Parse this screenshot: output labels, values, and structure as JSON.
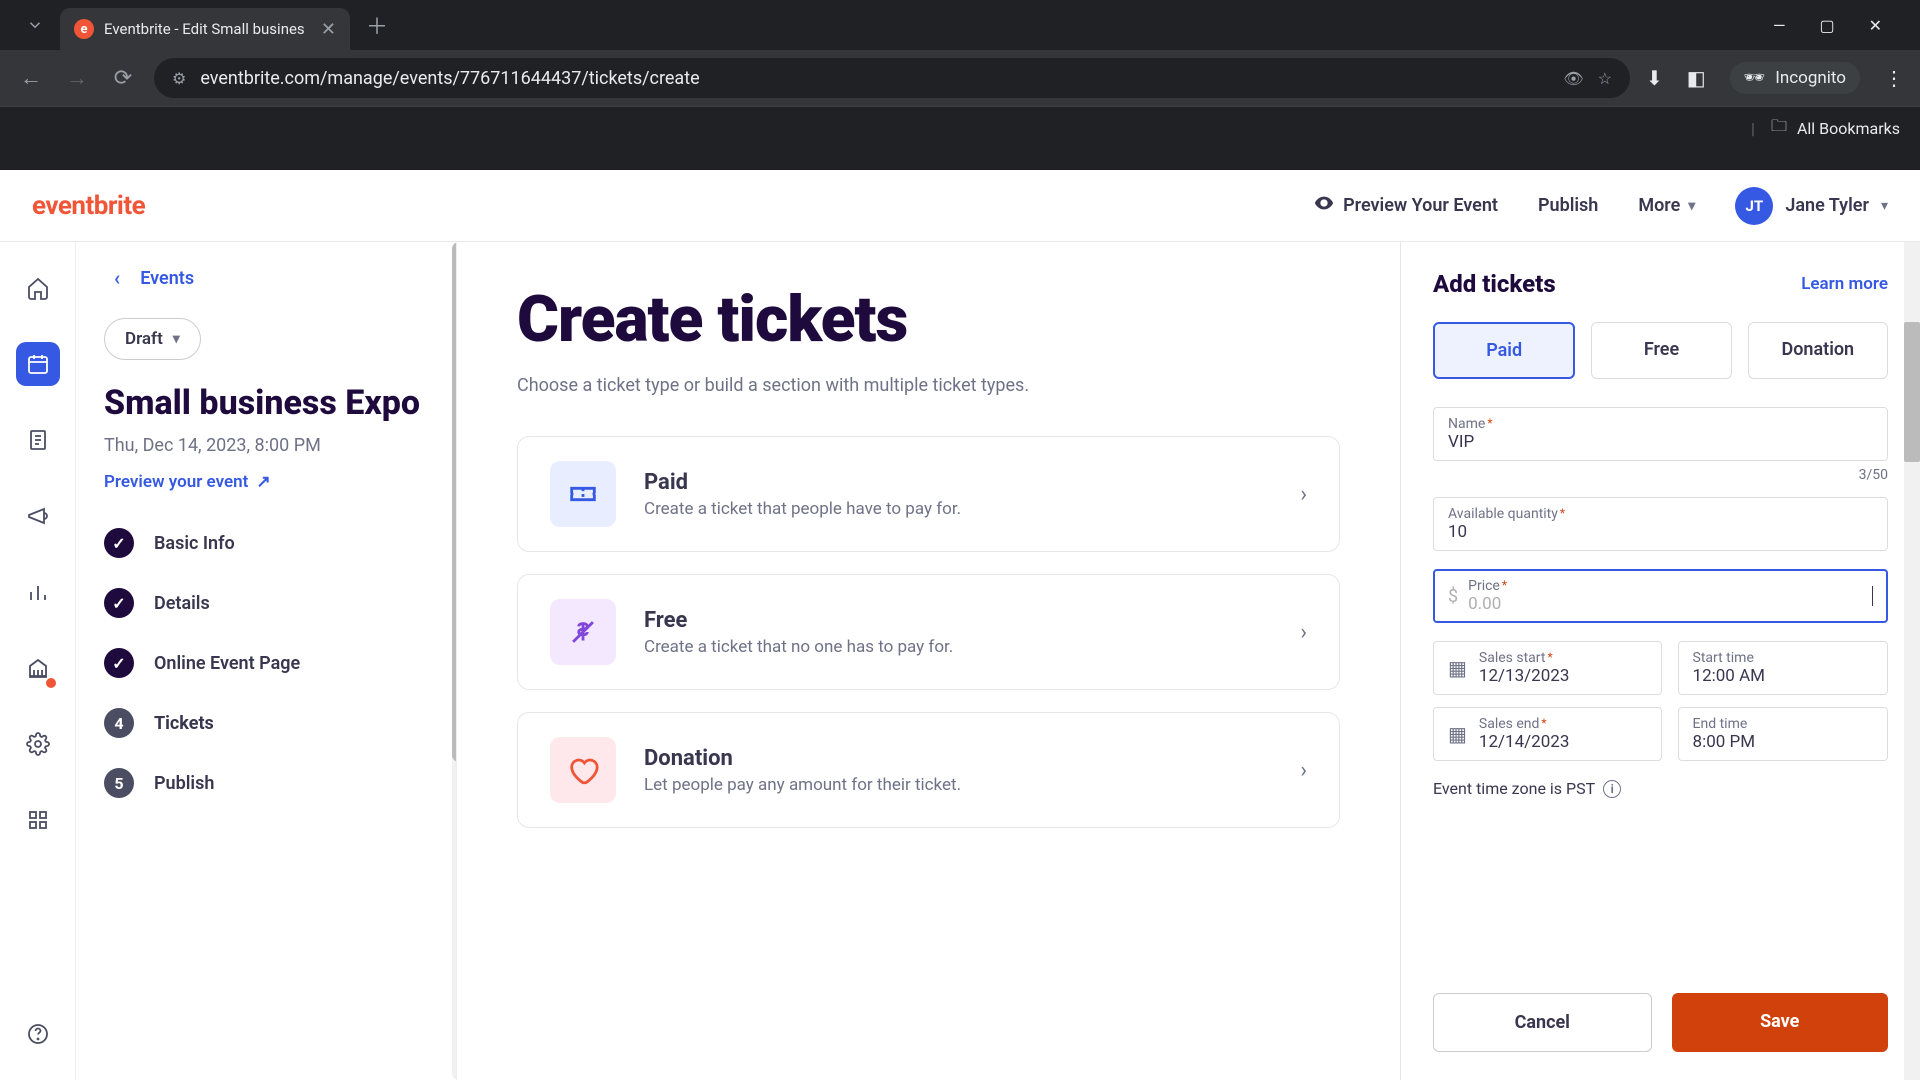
{
  "browser": {
    "tab_title": "Eventbrite - Edit Small busines",
    "url": "eventbrite.com/manage/events/776711644437/tickets/create",
    "incognito": "Incognito",
    "all_bookmarks": "All Bookmarks"
  },
  "header": {
    "logo": "eventbrite",
    "preview": "Preview Your Event",
    "publish": "Publish",
    "more": "More",
    "user_initials": "JT",
    "user_name": "Jane Tyler"
  },
  "sidebar": {
    "back": "Events",
    "draft": "Draft",
    "event_title": "Small business Expo",
    "event_date": "Thu, Dec 14, 2023, 8:00 PM",
    "preview_link": "Preview your event",
    "nav": {
      "basic": "Basic Info",
      "details": "Details",
      "online": "Online Event Page",
      "tickets_num": "4",
      "tickets": "Tickets",
      "publish_num": "5",
      "publish": "Publish"
    }
  },
  "main": {
    "title": "Create tickets",
    "subtitle": "Choose a ticket type or build a section with multiple ticket types.",
    "cards": {
      "paid_title": "Paid",
      "paid_desc": "Create a ticket that people have to pay for.",
      "free_title": "Free",
      "free_desc": "Create a ticket that no one has to pay for.",
      "donation_title": "Donation",
      "donation_desc": "Let people pay any amount for their ticket."
    }
  },
  "panel": {
    "title": "Add tickets",
    "learn": "Learn more",
    "tabs": {
      "paid": "Paid",
      "free": "Free",
      "donation": "Donation"
    },
    "name_label": "Name",
    "name_value": "VIP",
    "name_counter": "3/50",
    "qty_label": "Available quantity",
    "qty_value": "10",
    "price_label": "Price",
    "price_symbol": "$",
    "price_placeholder": "0.00",
    "sales_start_label": "Sales start",
    "sales_start_value": "12/13/2023",
    "start_time_label": "Start time",
    "start_time_value": "12:00 AM",
    "sales_end_label": "Sales end",
    "sales_end_value": "12/14/2023",
    "end_time_label": "End time",
    "end_time_value": "8:00 PM",
    "tz_note": "Event time zone is PST",
    "cancel": "Cancel",
    "save": "Save"
  }
}
